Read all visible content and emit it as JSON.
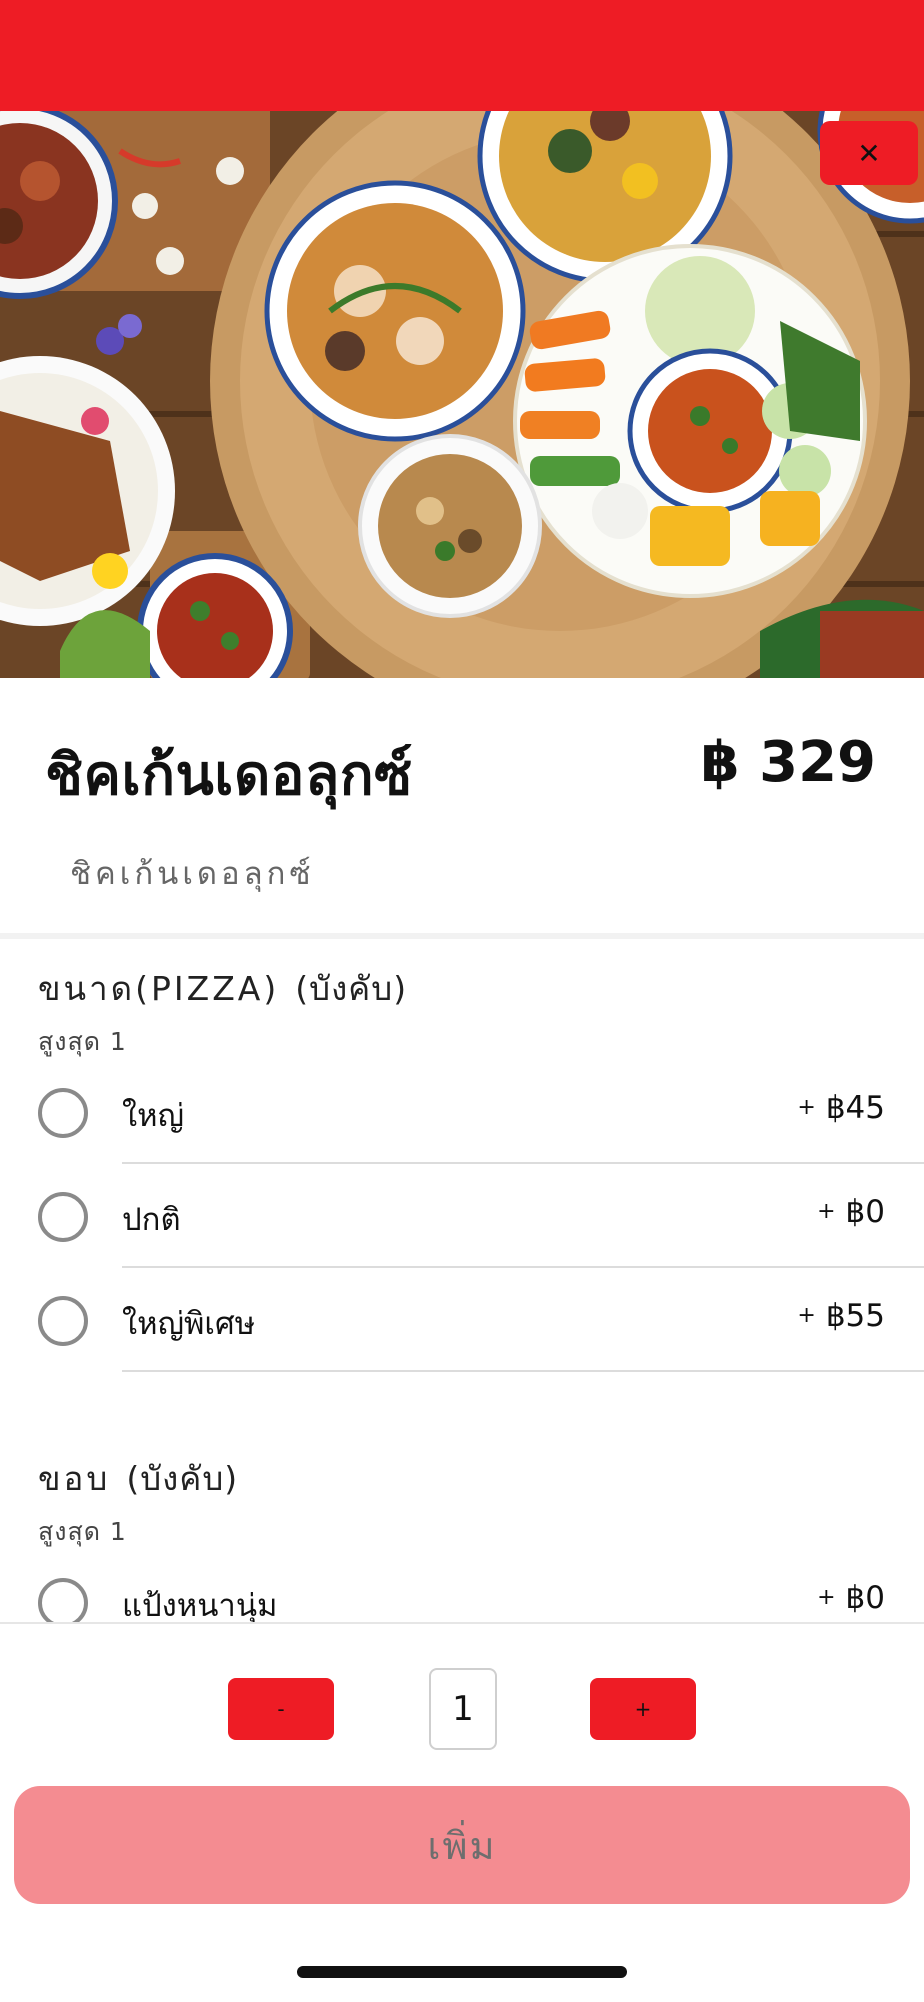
{
  "header": {
    "close_glyph": "✕"
  },
  "item": {
    "title": "ชิคเก้นเดอลุกซ์",
    "price": "฿ 329",
    "description": "ชิคเก้นเดอลุกซ์"
  },
  "sections": [
    {
      "title": "ขนาด(PIZZA)",
      "required": "(บังคับ)",
      "max": "สูงสุด 1",
      "options": [
        {
          "label": "ใหญ่",
          "plus": "+",
          "price": "฿45"
        },
        {
          "label": "ปกติ",
          "plus": "+",
          "price": "฿0"
        },
        {
          "label": "ใหญ่พิเศษ",
          "plus": "+",
          "price": "฿55"
        }
      ]
    },
    {
      "title": "ขอบ",
      "required": "(บังคับ)",
      "max": "สูงสุด 1",
      "options": [
        {
          "label": "แป้งหนานุ่ม",
          "plus": "+",
          "price": "฿0"
        }
      ]
    }
  ],
  "quantity": {
    "minus_label": "-",
    "value": "1",
    "plus_label": "+"
  },
  "add_button": {
    "label": "เพิ่ม"
  },
  "colors": {
    "brand_red": "#ee1c25",
    "add_button_bg": "#f48c91"
  }
}
